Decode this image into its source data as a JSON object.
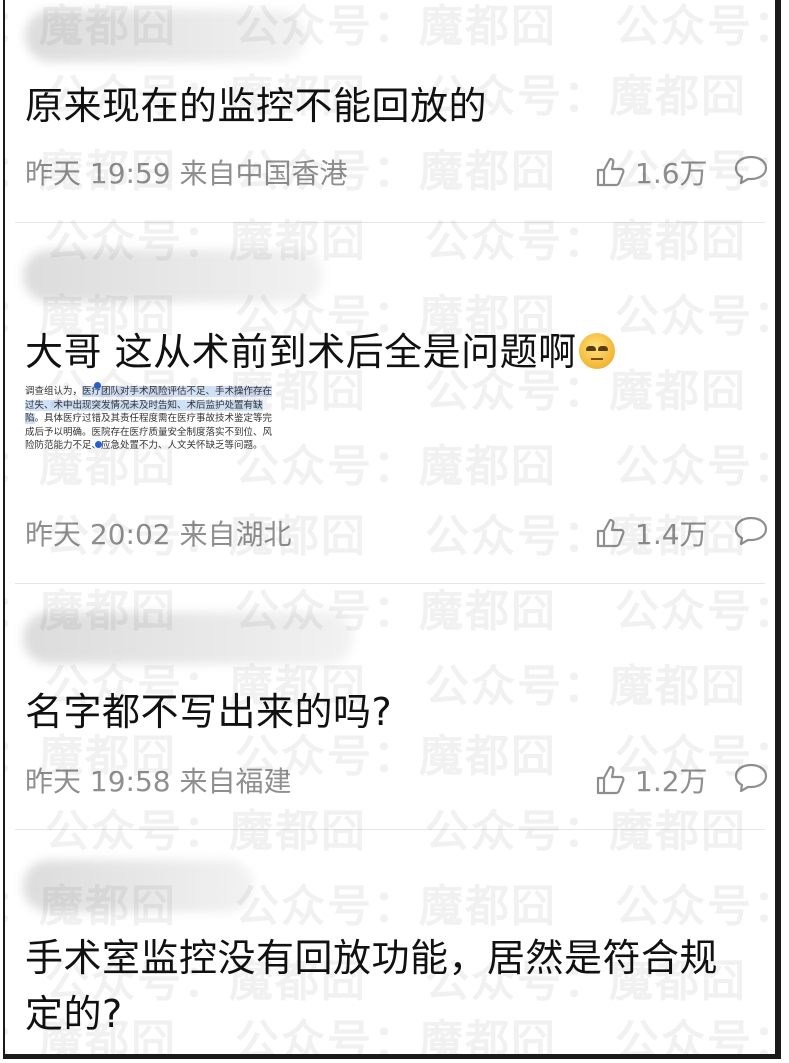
{
  "watermark": "公众号：魔都囧",
  "comments": [
    {
      "text": "原来现在的监控不能回放的",
      "time": "昨天 19:59",
      "source": "来自中国香港",
      "likes": "1.6万"
    },
    {
      "text": "大哥 这从术前到术后全是问题啊",
      "emoji": "eye-roll-emoji",
      "image_text_before": "调查组认为，",
      "image_text_highlight": "医疗团队对手术风险评估不足、手术操作存在过失、术中出现突发情况未及时告知、术后监护处置有缺陷",
      "image_text_after": "。具体医疗过错及其责任程度需在医疗事故技术鉴定等完成后予以明确。医院存在医疗质量安全制度落实不到位、风险防范能力不足、应急处置不力、人文关怀缺乏等问题。",
      "time": "昨天 20:02",
      "source": "来自湖北",
      "likes": "1.4万"
    },
    {
      "text": "名字都不写出来的吗?",
      "time": "昨天 19:58",
      "source": "来自福建",
      "likes": "1.2万"
    },
    {
      "text": "手术室监控没有回放功能，居然是符合规定的?"
    }
  ],
  "icons": {
    "like": "thumbs-up-icon",
    "reply": "speech-bubble-icon"
  },
  "colors": {
    "meta_text": "#8f8f8f",
    "highlight": "#cfe0f7",
    "selection_handle": "#2a63d6"
  }
}
